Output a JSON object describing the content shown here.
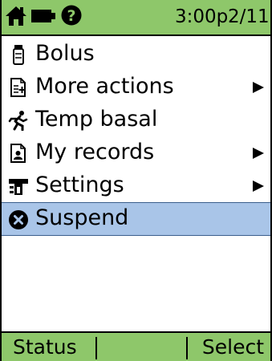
{
  "status_bar": {
    "time": "3:00p",
    "date": "2/11",
    "icons": [
      "home-icon",
      "battery-icon",
      "help-icon"
    ]
  },
  "menu": {
    "items": [
      {
        "label": "Bolus",
        "icon": "insulin-vial-icon",
        "submenu": false,
        "selected": false
      },
      {
        "label": "More actions",
        "icon": "document-plus-icon",
        "submenu": true,
        "selected": false
      },
      {
        "label": "Temp basal",
        "icon": "running-person-icon",
        "submenu": false,
        "selected": false
      },
      {
        "label": "My records",
        "icon": "records-document-icon",
        "submenu": true,
        "selected": false
      },
      {
        "label": "Settings",
        "icon": "wrench-settings-icon",
        "submenu": true,
        "selected": false
      },
      {
        "label": "Suspend",
        "icon": "stop-x-circle-icon",
        "submenu": false,
        "selected": true
      }
    ]
  },
  "softkeys": {
    "left_label": "Status",
    "right_label": "Select"
  },
  "colors": {
    "bar_green": "#8ec76a",
    "selection_blue": "#a9c5e8",
    "text": "#000000"
  }
}
